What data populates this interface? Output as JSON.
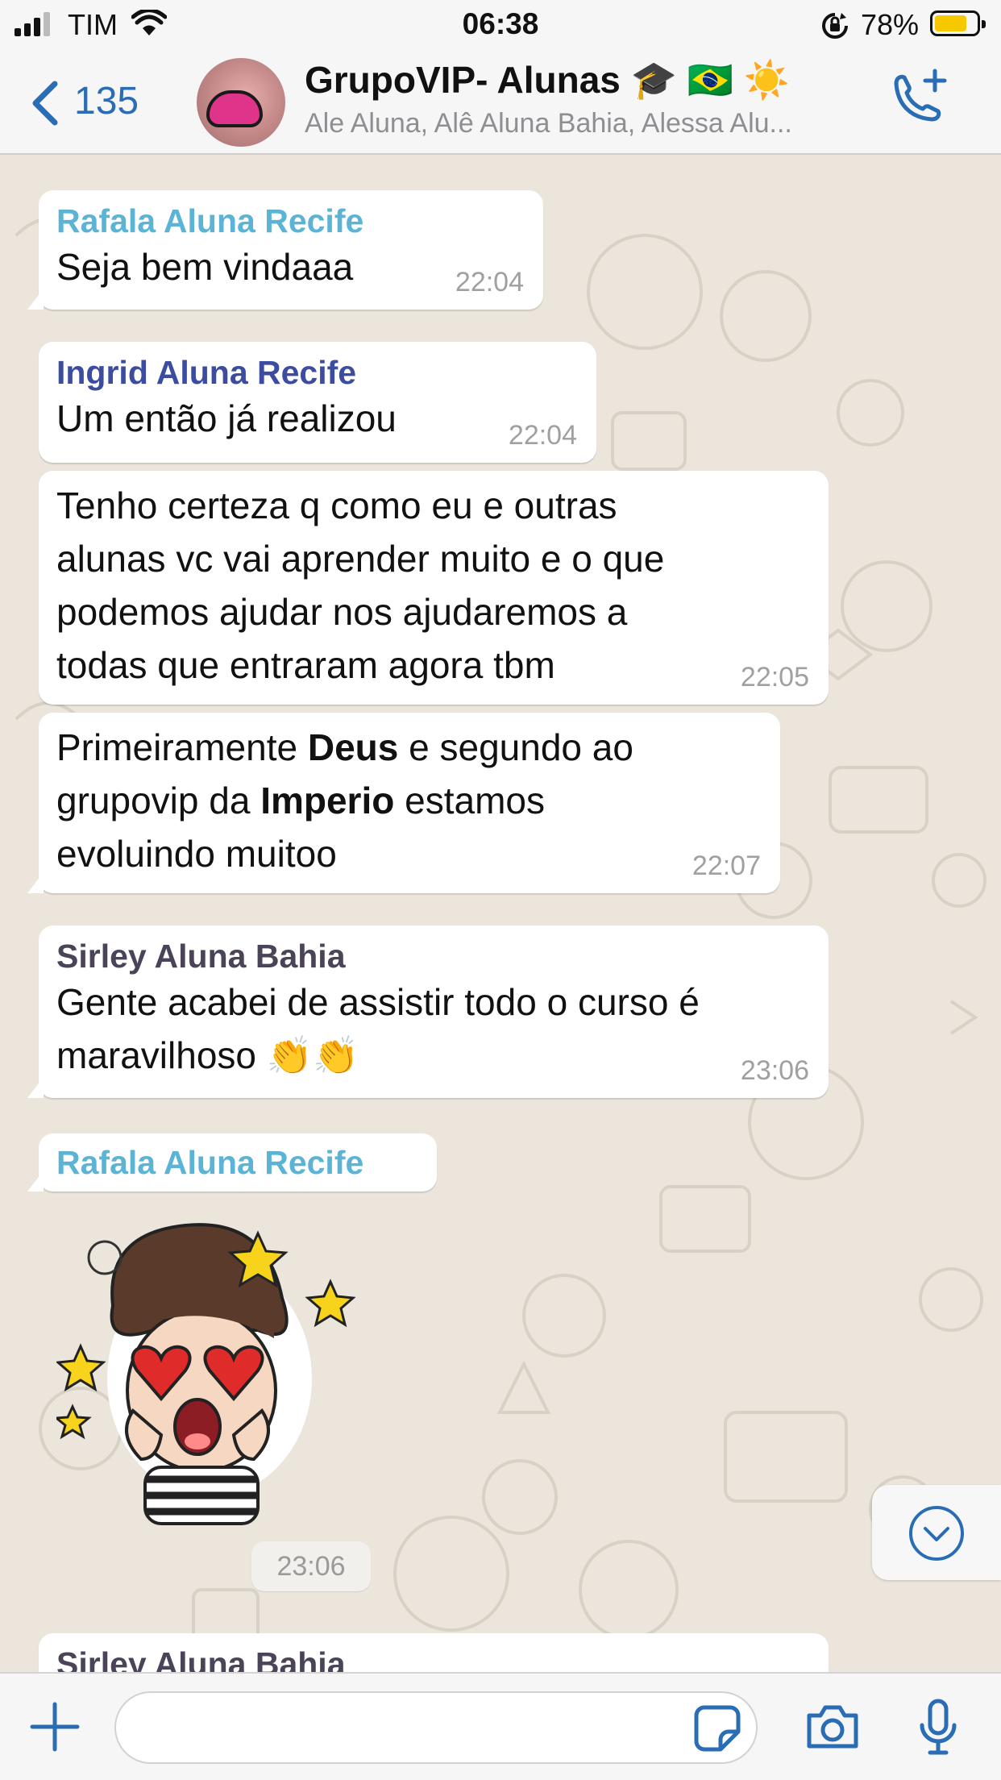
{
  "status_bar": {
    "carrier": "TIM",
    "time": "06:38",
    "battery": "78%",
    "battery_level": 0.78
  },
  "header": {
    "back_count": "135",
    "group_name": "GrupoVIP- Alunas 🎓 🇧🇷 ☀️",
    "members": "Ale Aluna, Alê Aluna Bahia, Alessa Alu..."
  },
  "colors": {
    "accent": "#2a6db5",
    "sender_rafala": "#5bb4d6",
    "sender_ingrid": "#3c4ca0",
    "sender_sirley": "#4b4458"
  },
  "messages": [
    {
      "sender": "Rafala Aluna Recife",
      "text": "Seja bem vindaaa",
      "time": "22:04"
    },
    {
      "sender": "Ingrid Aluna Recife",
      "text": "Um então já realizou",
      "time": "22:04"
    },
    {
      "lines": [
        "Tenho certeza q como eu e outras",
        "alunas vc vai aprender muito e o que",
        "podemos ajudar nos ajudaremos a",
        "todas que entraram agora tbm"
      ],
      "time": "22:05"
    },
    {
      "line1_a": "Primeiramente ",
      "line1_b": "Deus",
      "line1_c": " e segundo ao",
      "line2_a": "grupovip da ",
      "line2_b": "Imperio",
      "line2_c": " estamos",
      "line3": "evoluindo muitoo",
      "time": "22:07"
    },
    {
      "sender": "Sirley Aluna Bahia",
      "line1": "Gente acabei de assistir todo o curso é",
      "line2": "maravilhoso 👏👏",
      "time": "23:06"
    },
    {
      "sender": "Rafala Aluna Recife",
      "sticker": "heart-eyes-girl-sticker",
      "time": "23:06"
    },
    {
      "sender": "Sirley Aluna Bahia"
    }
  ],
  "input": {
    "placeholder": ""
  },
  "icons": [
    "signal-icon",
    "wifi-icon",
    "rotation-lock-icon",
    "battery-icon",
    "back-chevron-icon",
    "add-call-icon",
    "plus-icon",
    "sticker-icon",
    "camera-icon",
    "microphone-icon",
    "chevron-down-icon"
  ]
}
